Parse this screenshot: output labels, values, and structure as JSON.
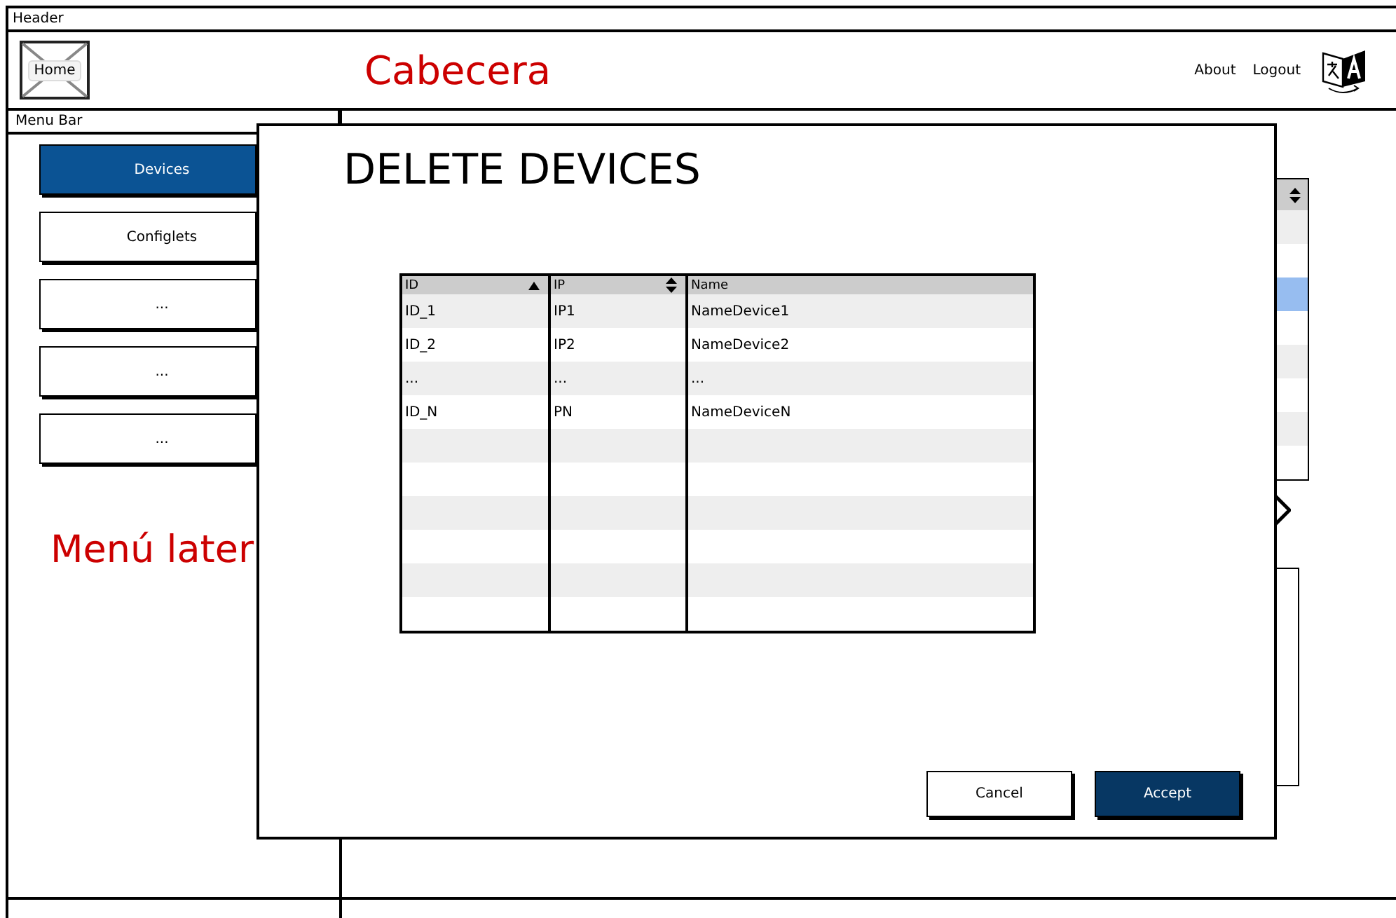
{
  "header": {
    "title": "Header",
    "logo_button": "Home",
    "heading": "Cabecera",
    "links": [
      "About",
      "Logout"
    ]
  },
  "menu": {
    "title": "Menu Bar",
    "items": [
      {
        "label": "Devices",
        "selected": true
      },
      {
        "label": "Configlets",
        "selected": false
      },
      {
        "label": "...",
        "selected": false
      },
      {
        "label": "...",
        "selected": false
      },
      {
        "label": "...",
        "selected": false
      }
    ],
    "note": "Menú later"
  },
  "background_table": {
    "sortable": true,
    "rows": [
      {
        "selected": false
      },
      {
        "selected": false
      },
      {
        "selected": true
      },
      {
        "selected": false
      },
      {
        "selected": false
      },
      {
        "selected": false
      },
      {
        "selected": false
      },
      {
        "selected": false
      }
    ]
  },
  "dialog": {
    "title": "DELETE DEVICES",
    "table": {
      "columns": [
        {
          "label": "ID",
          "sortable": true,
          "sorted_ascending": true
        },
        {
          "label": "IP",
          "sortable": true,
          "sorted_ascending": false
        },
        {
          "label": "Name",
          "sortable": false
        }
      ],
      "rows": [
        [
          "ID_1",
          "IP1",
          "NameDevice1"
        ],
        [
          "ID_2",
          "IP2",
          "NameDevice2"
        ],
        [
          "...",
          "...",
          "..."
        ],
        [
          "ID_N",
          "PN",
          "NameDeviceN"
        ]
      ]
    },
    "buttons": [
      {
        "label": "Cancel",
        "kind": "secondary"
      },
      {
        "label": "Accept",
        "kind": "primary"
      }
    ]
  }
}
